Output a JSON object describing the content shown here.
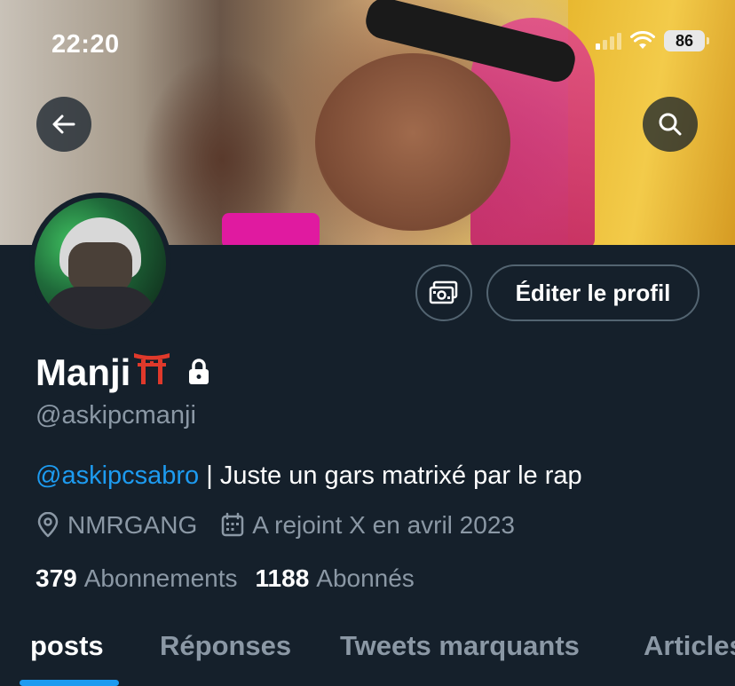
{
  "status_bar": {
    "time": "22:20",
    "battery": "86",
    "icons": [
      "cellular-signal-icon",
      "wifi-icon",
      "battery-icon"
    ]
  },
  "header": {
    "back_icon": "arrow-left-icon",
    "search_icon": "search-icon"
  },
  "profile": {
    "display_name": "Manji",
    "name_emoji": "⛩",
    "protected_icon": "lock-icon",
    "handle": "@askipcmanji",
    "bio_mention": "@askipcsabro",
    "bio_text": " | Juste un gars matrixé par le rap",
    "location": "NMRGANG",
    "joined": "A rejoint X en avril 2023",
    "following_count": "379",
    "following_label": "Abonnements",
    "followers_count": "1188",
    "followers_label": "Abonnés"
  },
  "actions": {
    "subscription_icon": "money-icon",
    "edit_profile_label": "Éditer le profil"
  },
  "tabs": [
    {
      "label": "posts",
      "active": true
    },
    {
      "label": "Réponses",
      "active": false
    },
    {
      "label": "Tweets marquants",
      "active": false
    },
    {
      "label": "Articles",
      "active": false
    }
  ],
  "colors": {
    "background": "#15202b",
    "accent": "#1d9bf0",
    "secondary_text": "#8b98a5",
    "border": "#536471"
  }
}
